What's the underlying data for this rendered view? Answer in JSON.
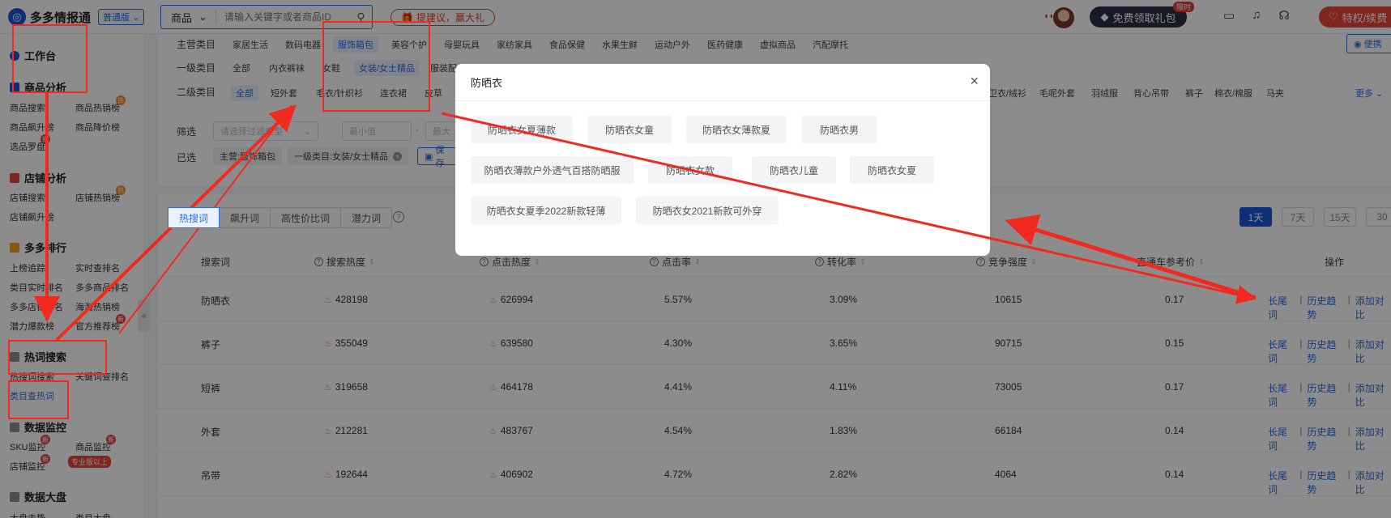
{
  "topbar": {
    "logo_text": "多多情报通",
    "version": "普通版",
    "search_type": "商品",
    "search_placeholder": "请输入关键字或者商品ID",
    "feedback": "提建议，赢大礼",
    "gift_button": "免费领取礼包",
    "limited_tag": "限时",
    "vip_button": "特权/续费"
  },
  "sidebar": {
    "workbench": "工作台",
    "sections": [
      {
        "title": "商品分析",
        "items": [
          "商品搜索",
          "商品热销榜",
          "商品飙升榜",
          "商品降价榜",
          "选品罗盘"
        ]
      },
      {
        "title": "店铺分析",
        "items": [
          "店铺搜索",
          "店铺热销榜",
          "店铺飙升榜"
        ]
      },
      {
        "title": "多多排行",
        "items": [
          "上榜追踪",
          "实时查排名",
          "类目实时排名",
          "多多商品排名",
          "多多店铺排名",
          "海淘热销榜",
          "潜力爆款榜",
          "官方推荐榜"
        ]
      },
      {
        "title": "热词搜索",
        "items": [
          "热搜词搜索",
          "关键词查排名",
          "类目查热词"
        ]
      },
      {
        "title": "数据监控",
        "items": [
          "SKU监控",
          "商品监控",
          "店铺监控"
        ]
      },
      {
        "title": "数据大盘",
        "items": [
          "大盘走势",
          "类目大盘"
        ]
      }
    ],
    "new_badge": "新",
    "pro_tag": "专业版以上"
  },
  "filters": {
    "main_label": "主营类目",
    "main_items": [
      "家居生活",
      "数码电器",
      "服饰箱包",
      "美容个护",
      "母婴玩具",
      "家纺家具",
      "食品保健",
      "水果生鲜",
      "运动户外",
      "医药健康",
      "虚拟商品",
      "汽配摩托"
    ],
    "level1_label": "一级类目",
    "level1_items": [
      "全部",
      "内衣裤袜",
      "女鞋",
      "女装/女士精品",
      "服装配"
    ],
    "level2_label": "二级类目",
    "level2_items": [
      "全部",
      "短外套",
      "毛衣/针织衫",
      "连衣裙",
      "皮草"
    ],
    "level2_right_items": [
      "卫衣/绒衫",
      "毛呢外套",
      "羽绒服",
      "背心吊带",
      "裤子",
      "棉衣/棉服",
      "马夹"
    ],
    "more": "更多",
    "screen_label": "筛选",
    "screen_select": "请选择过滤类型",
    "min_placeholder": "最小值",
    "max_placeholder": "最大",
    "selected_label": "已选",
    "selected_tags": [
      "主营:服饰箱包",
      "一级类目:女装/女士精品"
    ],
    "save_label": "保存",
    "side_tool": "便携"
  },
  "table": {
    "tabs": [
      "热搜词",
      "飙升词",
      "高性价比词",
      "潜力词"
    ],
    "day_buttons": [
      "1天",
      "7天",
      "15天",
      "30"
    ],
    "headers": [
      "搜索词",
      "搜索热度",
      "点击热度",
      "点击率",
      "转化率",
      "竞争强度",
      "直通车参考价",
      "操作"
    ],
    "rows": [
      {
        "word": "防晒衣",
        "search": "428198",
        "click": "626994",
        "ctr": "5.57%",
        "cvr": "3.09%",
        "comp": "10615",
        "price": "0.17"
      },
      {
        "word": "裤子",
        "search": "355049",
        "click": "639580",
        "ctr": "4.30%",
        "cvr": "3.65%",
        "comp": "90715",
        "price": "0.15"
      },
      {
        "word": "短裤",
        "search": "319658",
        "click": "464178",
        "ctr": "4.41%",
        "cvr": "4.11%",
        "comp": "73005",
        "price": "0.17"
      },
      {
        "word": "外套",
        "search": "212281",
        "click": "483767",
        "ctr": "4.54%",
        "cvr": "1.83%",
        "comp": "66184",
        "price": "0.14"
      },
      {
        "word": "吊带",
        "search": "192644",
        "click": "406902",
        "ctr": "4.72%",
        "cvr": "2.82%",
        "comp": "4064",
        "price": "0.14"
      }
    ],
    "ops": [
      "长尾词",
      "历史趋势",
      "添加对比"
    ]
  },
  "modal": {
    "title": "防晒衣",
    "keywords": [
      "防晒衣女夏薄款",
      "防晒衣女童",
      "防晒衣女薄款夏",
      "防晒衣男",
      "防晒衣薄款户外透气百搭防晒服",
      "防晒衣女款",
      "防晒衣儿童",
      "防晒衣女夏",
      "防晒衣女夏季2022新款轻薄",
      "防晒衣女2021新款可外穿"
    ]
  },
  "colors": {
    "accent": "#2d6cdf",
    "annotation": "#f2291f"
  }
}
